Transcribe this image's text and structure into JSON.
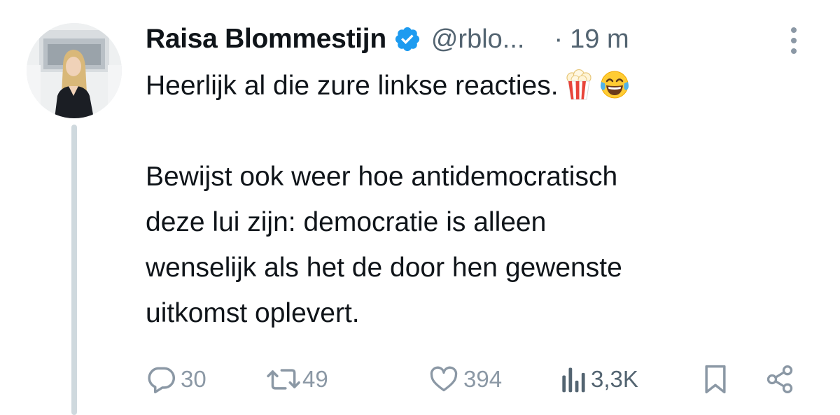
{
  "tweet": {
    "author": {
      "display_name": "Raisa Blommestijn",
      "handle": "@rblo...",
      "verified": true,
      "avatar": "profile-photo"
    },
    "separator": "·",
    "timestamp": "19 m",
    "text_line_1": "Heerlijk al die zure linkse reacties.",
    "emojis": [
      "popcorn-emoji",
      "tears-of-joy-emoji"
    ],
    "paragraph_2_lines": [
      "Bewijst ook weer hoe antidemocratisch",
      "deze lui zijn: democratie is alleen",
      "wenselijk als het de door hen gewenste",
      "uitkomst oplevert."
    ]
  },
  "actions": {
    "reply": {
      "icon": "reply-icon",
      "count": "30"
    },
    "retweet": {
      "icon": "retweet-icon",
      "count": "49"
    },
    "like": {
      "icon": "heart-icon",
      "count": "394"
    },
    "views": {
      "icon": "views-icon",
      "count": "3,3K"
    },
    "bookmark": {
      "icon": "bookmark-icon"
    },
    "share": {
      "icon": "share-icon"
    }
  },
  "colors": {
    "text": "#0f1419",
    "secondary": "#536471",
    "icon_muted": "#8b98a5",
    "verified_blue": "#1d9bf0",
    "thread_line": "#cfd9de"
  }
}
